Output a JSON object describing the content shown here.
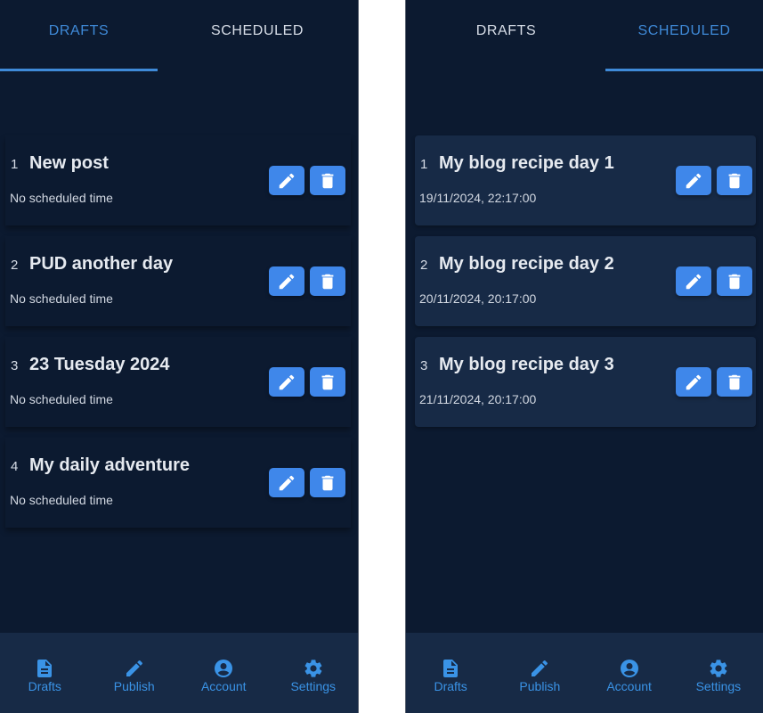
{
  "screens": {
    "drafts": {
      "tabs": [
        {
          "label": "DRAFTS",
          "active": true
        },
        {
          "label": "SCHEDULED",
          "active": false
        }
      ],
      "items": [
        {
          "index": "1",
          "title": "New post",
          "subtitle": "No scheduled time"
        },
        {
          "index": "2",
          "title": "PUD another day",
          "subtitle": "No scheduled time"
        },
        {
          "index": "3",
          "title": "23 Tuesday 2024",
          "subtitle": "No scheduled time"
        },
        {
          "index": "4",
          "title": "My daily adventure",
          "subtitle": "No scheduled time"
        }
      ]
    },
    "scheduled": {
      "tabs": [
        {
          "label": "DRAFTS",
          "active": false
        },
        {
          "label": "SCHEDULED",
          "active": true
        }
      ],
      "items": [
        {
          "index": "1",
          "title": "My blog recipe day 1",
          "subtitle": "19/11/2024, 22:17:00"
        },
        {
          "index": "2",
          "title": "My blog recipe day 2",
          "subtitle": "20/11/2024, 20:17:00"
        },
        {
          "index": "3",
          "title": "My blog recipe day 3",
          "subtitle": "21/11/2024, 20:17:00"
        }
      ]
    }
  },
  "actions": {
    "edit_icon": "pencil-icon",
    "delete_icon": "trash-icon"
  },
  "bottom_nav": [
    {
      "label": "Drafts",
      "icon": "document-icon"
    },
    {
      "label": "Publish",
      "icon": "pencil-icon"
    },
    {
      "label": "Account",
      "icon": "account-circle-icon"
    },
    {
      "label": "Settings",
      "icon": "gear-icon"
    }
  ],
  "colors": {
    "background": "#0c1a30",
    "card_scheduled": "#172a46",
    "accent": "#3f8ad8",
    "button": "#3f87ea",
    "nav_bar": "#172a46",
    "nav_accent": "#3a93e6"
  }
}
